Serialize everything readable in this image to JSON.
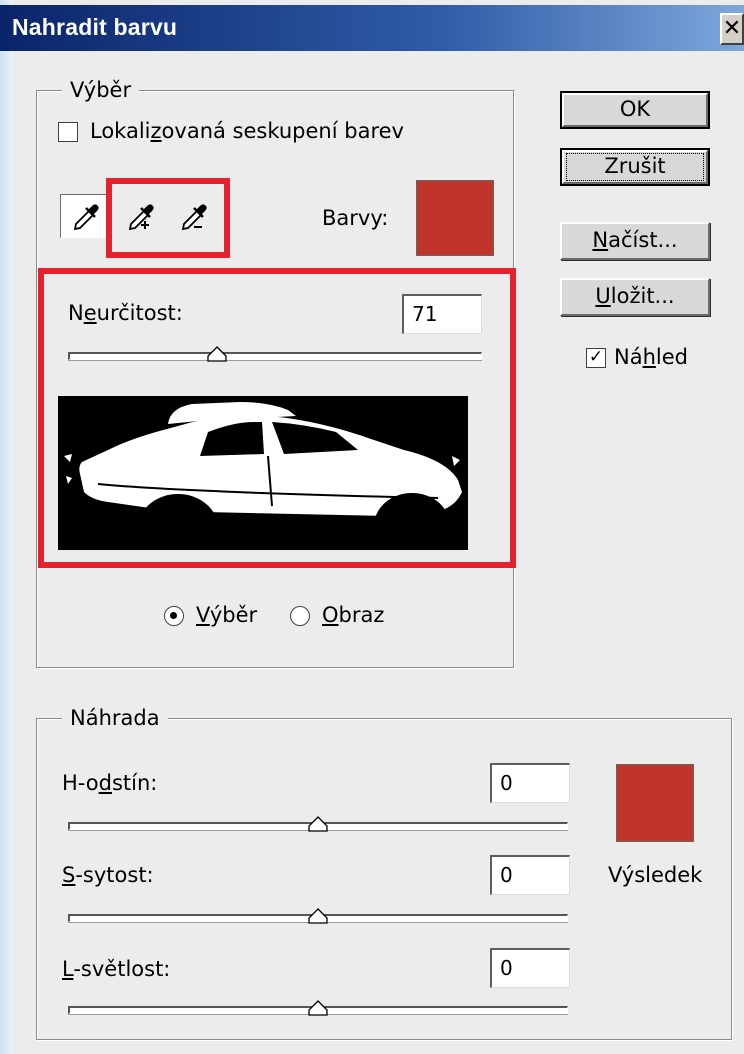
{
  "window": {
    "title": "Nahradit barvu",
    "close_glyph": "✕"
  },
  "selection_group": {
    "title": "Výběr",
    "localized_clusters": {
      "label_before": "Lokali",
      "label_underlined": "z",
      "label_after": "ovaná seskupení barev",
      "checked": false
    },
    "tools": [
      {
        "name": "eyedropper-icon",
        "pressed": true
      },
      {
        "name": "eyedropper-plus-icon",
        "pressed": false
      },
      {
        "name": "eyedropper-minus-icon",
        "pressed": false
      }
    ],
    "colors_label": "Barvy:",
    "colors_swatch": "#c0342a",
    "fuzziness": {
      "label_before": "N",
      "label_underlined": "e",
      "label_after": "určitost:",
      "value": "71",
      "slider_fraction": 0.36
    },
    "radio_selection": {
      "label_underlined": "V",
      "label_after": "ýběr",
      "checked": true
    },
    "radio_image": {
      "label_underlined": "O",
      "label_after": "braz",
      "checked": false
    }
  },
  "buttons": {
    "ok": "OK",
    "cancel": "Zrušit",
    "load": {
      "underlined": "N",
      "rest": "ačíst..."
    },
    "save": {
      "underlined": "U",
      "rest": "ložit..."
    }
  },
  "preview_checkbox": {
    "label_before": "Ná",
    "label_underlined": "h",
    "label_after": "led",
    "checked": true
  },
  "replacement_group": {
    "title": "Náhrada",
    "hue": {
      "label_before": "H-o",
      "label_underlined": "d",
      "label_after": "stín:",
      "value": "0",
      "slider_fraction": 0.5
    },
    "saturation": {
      "label_before": "",
      "label_underlined": "S",
      "label_after": "-sytost:",
      "value": "0",
      "slider_fraction": 0.5
    },
    "lightness": {
      "label_before": "",
      "label_underlined": "L",
      "label_after": "-světlost:",
      "value": "0",
      "slider_fraction": 0.5
    },
    "result_label": "Výsledek",
    "result_swatch": "#c0342a"
  },
  "colors": {
    "highlight_red": "#e5232e"
  }
}
